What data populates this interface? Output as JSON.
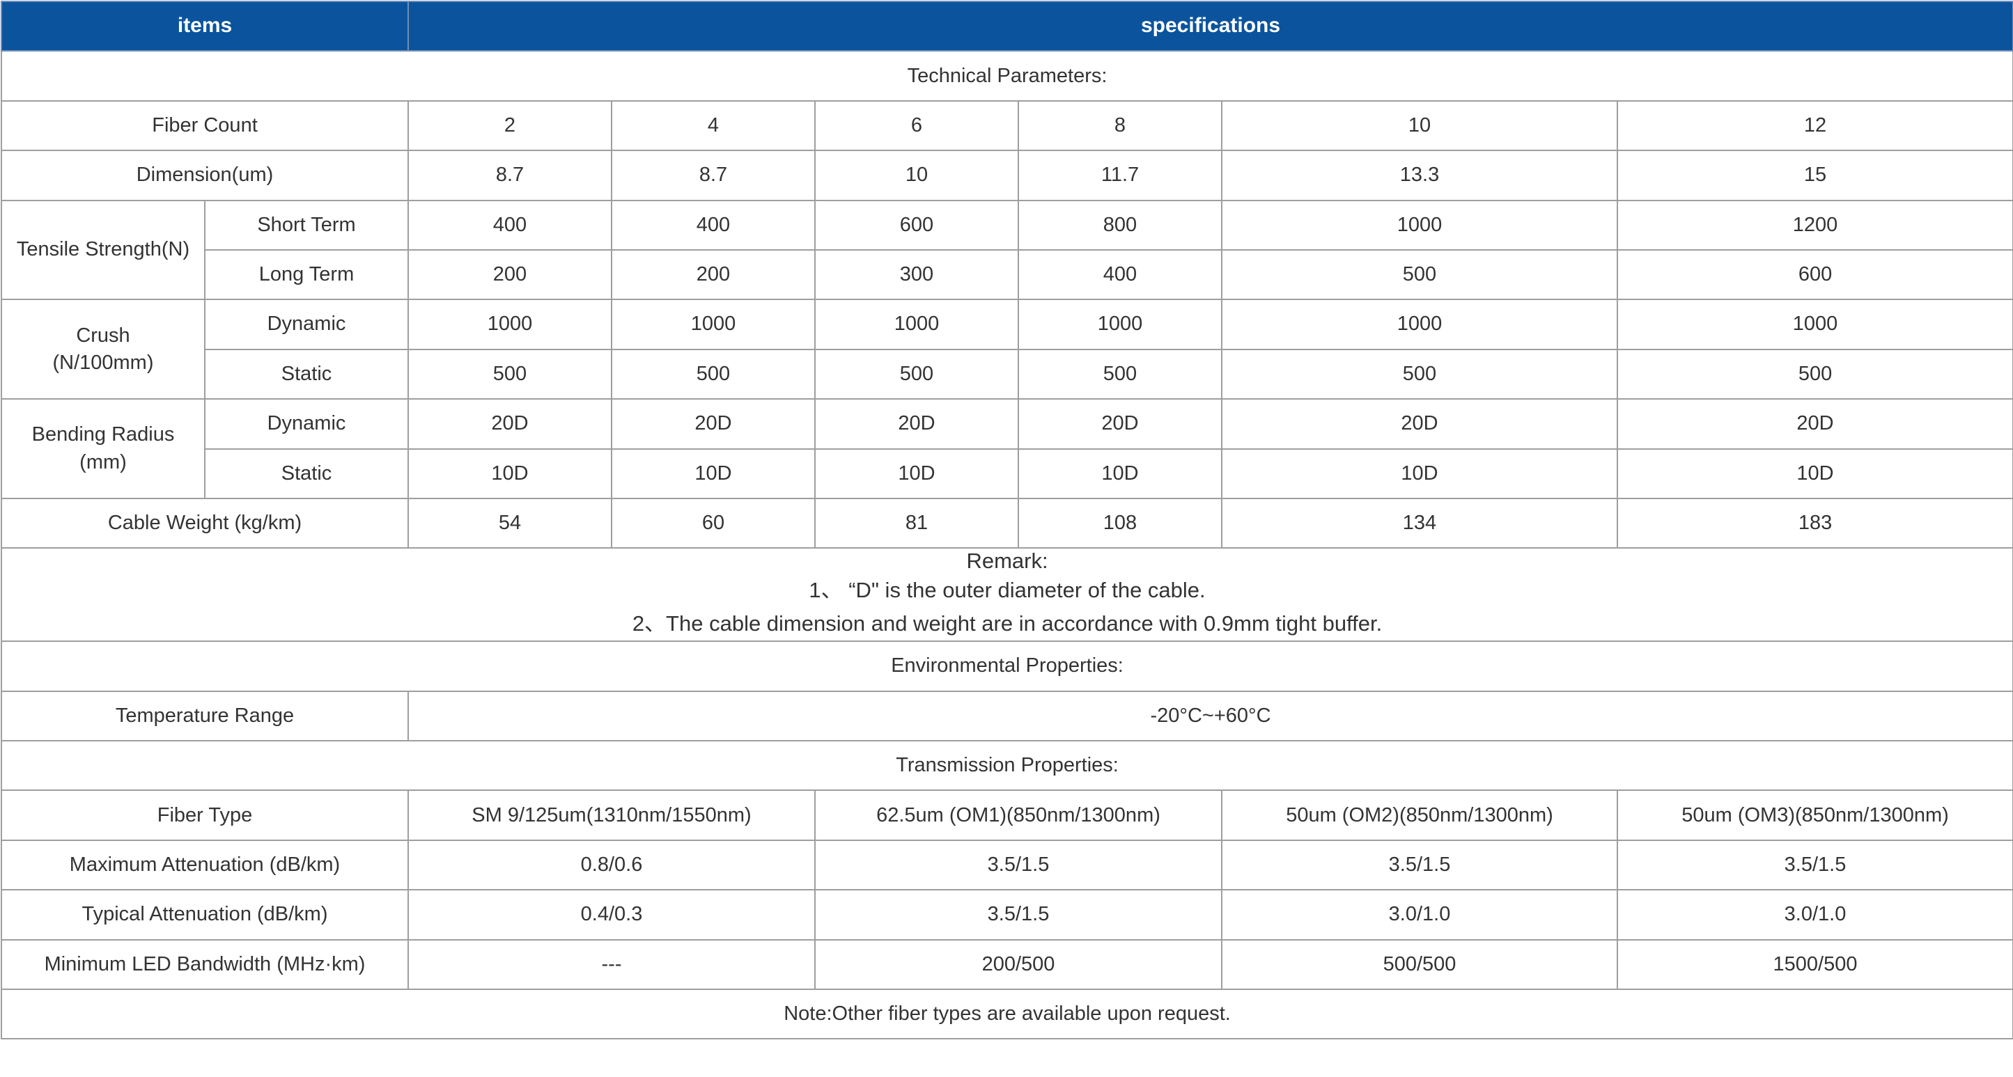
{
  "header": {
    "items": "items",
    "specifications": "specifications"
  },
  "technical": {
    "title": "Technical Parameters:",
    "fiber_count": {
      "label": "Fiber Count",
      "values": [
        "2",
        "4",
        "6",
        "8",
        "10",
        "12"
      ]
    },
    "dimension": {
      "label": "Dimension(um)",
      "values": [
        "8.7",
        "8.7",
        "10",
        "11.7",
        "13.3",
        "15"
      ]
    },
    "tensile": {
      "label": "Tensile Strength(N)",
      "short": {
        "label": "Short Term",
        "values": [
          "400",
          "400",
          "600",
          "800",
          "1000",
          "1200"
        ]
      },
      "long": {
        "label": "Long Term",
        "values": [
          "200",
          "200",
          "300",
          "400",
          "500",
          "600"
        ]
      }
    },
    "crush": {
      "label_line1": "Crush",
      "label_line2": "(N/100mm)",
      "dynamic": {
        "label": "Dynamic",
        "values": [
          "1000",
          "1000",
          "1000",
          "1000",
          "1000",
          "1000"
        ]
      },
      "static": {
        "label": "Static",
        "values": [
          "500",
          "500",
          "500",
          "500",
          "500",
          "500"
        ]
      }
    },
    "bending": {
      "label_line1": "Bending Radius",
      "label_line2": "(mm)",
      "dynamic": {
        "label": "Dynamic",
        "values": [
          "20D",
          "20D",
          "20D",
          "20D",
          "20D",
          "20D"
        ]
      },
      "static": {
        "label": "Static",
        "values": [
          "10D",
          "10D",
          "10D",
          "10D",
          "10D",
          "10D"
        ]
      }
    },
    "weight": {
      "label": "Cable Weight (kg/km)",
      "values": [
        "54",
        "60",
        "81",
        "108",
        "134",
        "183"
      ]
    }
  },
  "remark": {
    "title": "Remark:",
    "line1": "1、 “D\" is the outer diameter of the cable.",
    "line2": "2、The cable dimension and weight are in accordance with 0.9mm tight buffer."
  },
  "environmental": {
    "title": "Environmental Properties:",
    "temperature": {
      "label": "Temperature Range",
      "value": "-20°C~+60°C"
    }
  },
  "transmission": {
    "title": "Transmission Properties:",
    "fiber_type": {
      "label": "Fiber Type",
      "values": [
        "SM 9/125um(1310nm/1550nm)",
        "62.5um (OM1)(850nm/1300nm)",
        "50um (OM2)(850nm/1300nm)",
        "50um (OM3)(850nm/1300nm)"
      ]
    },
    "max_att": {
      "label": "Maximum Attenuation (dB/km)",
      "values": [
        "0.8/0.6",
        "3.5/1.5",
        "3.5/1.5",
        "3.5/1.5"
      ]
    },
    "typ_att": {
      "label": "Typical Attenuation (dB/km)",
      "values": [
        "0.4/0.3",
        "3.5/1.5",
        "3.0/1.0",
        "3.0/1.0"
      ]
    },
    "bandwidth": {
      "label": "Minimum LED Bandwidth (MHz·km)",
      "values": [
        "---",
        "200/500",
        "500/500",
        "1500/500"
      ]
    }
  },
  "note": "Note:Other fiber types are available upon request."
}
